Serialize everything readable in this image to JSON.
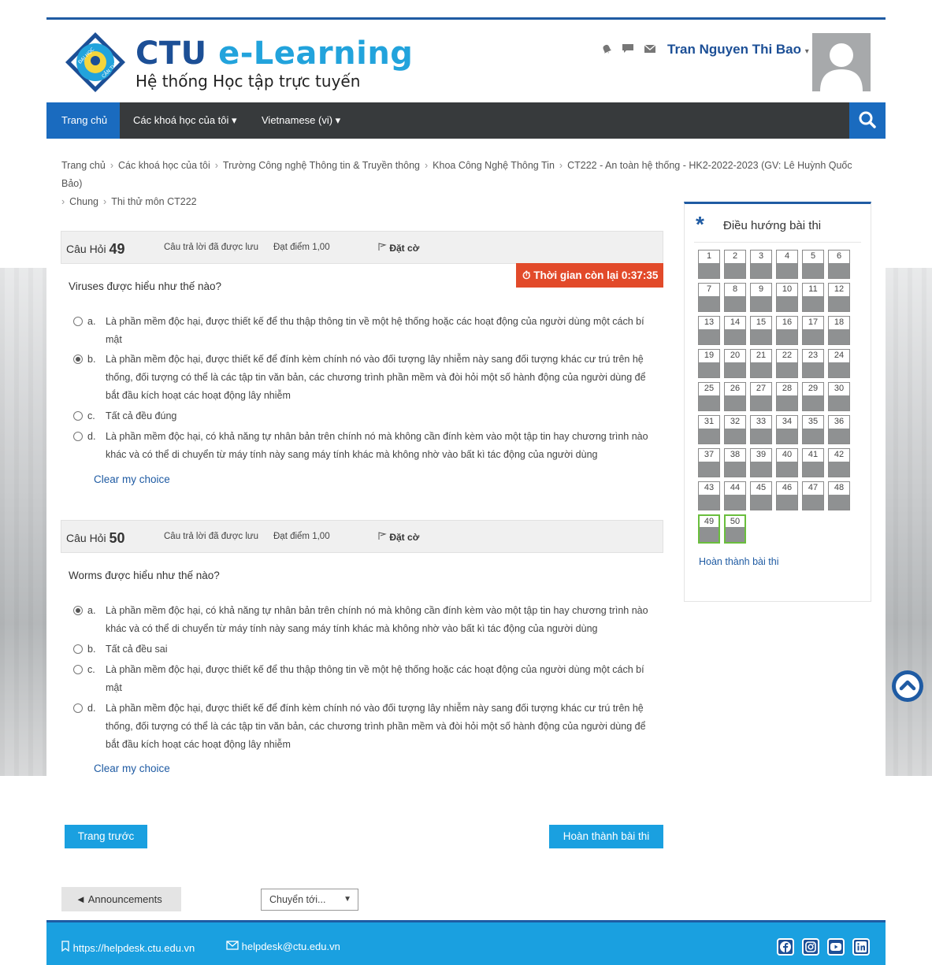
{
  "brand": {
    "title_part1": "CTU",
    "title_part2": "e-Learning",
    "subtitle": "Hệ thống Học tập trực tuyến",
    "seal_text_top": "ĐẠI HỌC",
    "seal_text_right": "CẦN THƠ"
  },
  "user": {
    "name": "Tran Nguyen Thi Bao",
    "caret": "▾"
  },
  "header_icons": [
    "bell-icon",
    "chat-icon",
    "envelope-icon"
  ],
  "nav": {
    "home": "Trang chủ",
    "courses": "Các khoá học của tôi ▾",
    "language": "Vietnamese (vi) ▾"
  },
  "breadcrumb": [
    "Trang chủ",
    "Các khoá học của tôi",
    "Trường Công nghệ Thông tin & Truyền thông",
    "Khoa Công Nghệ Thông Tin",
    "CT222 - An toàn hệ thống - HK2-2022-2023 (GV: Lê Huỳnh Quốc Bảo)",
    "Chung",
    "Thi thử môn CT222"
  ],
  "timer": {
    "label": "Thời gian còn lại 0:37:35"
  },
  "questions": [
    {
      "label": "Câu Hỏi",
      "number": "49",
      "status": "Câu trả lời đã được lưu",
      "mark": "Đạt điểm 1,00",
      "flag": "Đặt cờ",
      "text": "Viruses được hiểu như thế nào?",
      "options": [
        {
          "letter": "a.",
          "selected": false,
          "text": "Là phần mềm độc hại, được thiết kế để thu thập thông tin về một hệ thống hoặc các hoạt động của người dùng một cách bí mật"
        },
        {
          "letter": "b.",
          "selected": true,
          "text": "Là phần mềm độc hại, được thiết kế để đính kèm chính nó vào đối tượng lây nhiễm này sang đối tượng khác cư trú trên hệ thống, đối tượng có thể là các tập tin văn bản, các chương trình phần mềm và đòi hỏi một số hành động của người dùng để bắt đầu kích hoạt các hoạt động lây nhiễm"
        },
        {
          "letter": "c.",
          "selected": false,
          "text": "Tất cả đều đúng"
        },
        {
          "letter": "d.",
          "selected": false,
          "text": "Là phần mềm độc hại, có khả năng tự nhân bản trên chính nó mà không cần đính kèm vào một tập tin hay chương trình nào khác và có thể di chuyển từ máy tính này sang máy tính khác mà không nhờ vào bất kì tác động của người dùng"
        }
      ],
      "clear": "Clear my choice"
    },
    {
      "label": "Câu Hỏi",
      "number": "50",
      "status": "Câu trả lời đã được lưu",
      "mark": "Đạt điểm 1,00",
      "flag": "Đặt cờ",
      "text": "Worms được hiểu như thế nào?",
      "options": [
        {
          "letter": "a.",
          "selected": true,
          "text": "Là phần mềm độc hại, có khả năng tự nhân bản trên chính nó mà không cần đính kèm vào một tập tin hay chương trình nào khác và có thể di chuyển từ máy tính này sang máy tính khác mà không nhờ vào bất kì tác động của người dùng"
        },
        {
          "letter": "b.",
          "selected": false,
          "text": "Tất cả đều sai"
        },
        {
          "letter": "c.",
          "selected": false,
          "text": "Là phần mềm độc hại, được thiết kế để thu thập thông tin về một hệ thống hoặc các hoạt động của người dùng một cách bí mật"
        },
        {
          "letter": "d.",
          "selected": false,
          "text": "Là phần mềm độc hại, được thiết kế để đính kèm chính nó vào đối tượng lây nhiễm này sang đối tượng khác cư trú trên hệ thống, đối tượng có thể là các tập tin văn bản, các chương trình phần mềm và đòi hỏi một số hành động của người dùng để bắt đầu kích hoạt các hoạt động lây nhiễm"
        }
      ],
      "clear": "Clear my choice"
    }
  ],
  "quiz_nav": {
    "title": "Điều hướng bài thi",
    "question_count": 50,
    "current": [
      49,
      50
    ],
    "finish_link": "Hoàn thành bài thi"
  },
  "buttons": {
    "prev": "Trang trước",
    "finish": "Hoàn thành bài thi"
  },
  "announcements": "◄ Announcements",
  "jump_select": {
    "value": "Chuyển tới..."
  },
  "footer": {
    "helpdesk_url": "https://helpdesk.ctu.edu.vn",
    "email": "helpdesk@ctu.edu.vn",
    "social": [
      "facebook-icon",
      "instagram-icon",
      "youtube-icon",
      "linkedin-icon"
    ]
  },
  "colors": {
    "brand_dark": "#1c4f96",
    "brand_light": "#22a3dc",
    "primary_button": "#1aa0e0",
    "timer": "#e24a2a",
    "navbar": "#373a3c"
  }
}
